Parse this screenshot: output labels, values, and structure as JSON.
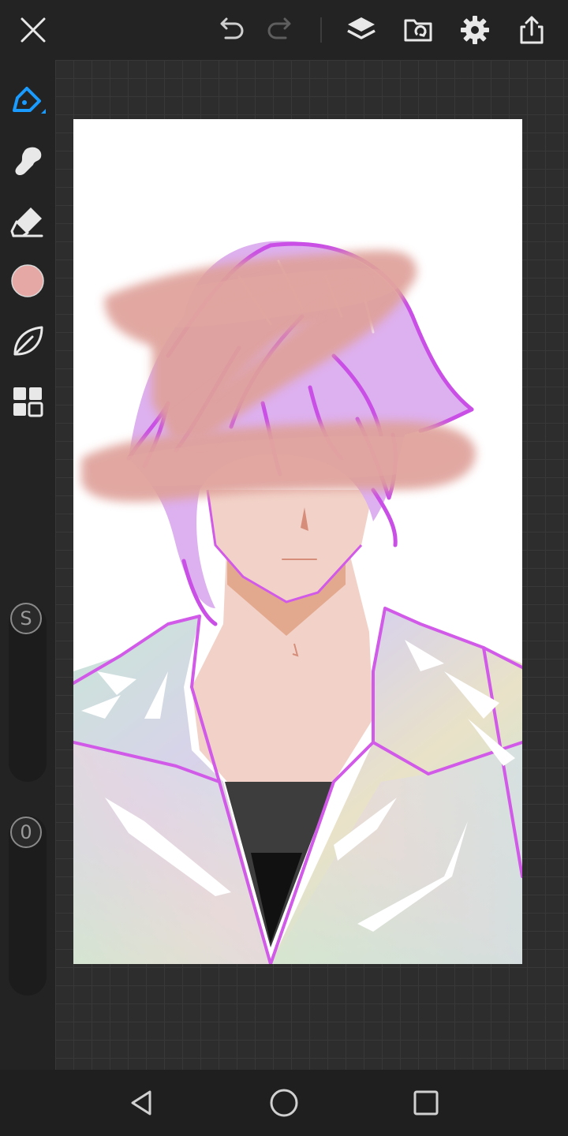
{
  "app": {
    "accent_color": "#1a9bff",
    "current_brush_color": "#e6a8a4"
  },
  "toolbar": {
    "close_icon": "close-icon",
    "undo_icon": "undo-icon",
    "redo_icon": "redo-icon",
    "layers_icon": "layers-icon",
    "gallery_icon": "gallery-icon",
    "settings_icon": "gear-icon",
    "share_icon": "share-icon"
  },
  "tools": [
    {
      "name": "pen",
      "icon": "pen-icon",
      "active": true
    },
    {
      "name": "smudge",
      "icon": "smudge-icon",
      "active": false
    },
    {
      "name": "eraser",
      "icon": "eraser-icon",
      "active": false
    },
    {
      "name": "color",
      "icon": "color-swatch",
      "active": false
    },
    {
      "name": "brush-library",
      "icon": "leaf-icon",
      "active": false
    },
    {
      "name": "widgets",
      "icon": "grid-icon",
      "active": false
    }
  ],
  "sliders": {
    "size_label": "S",
    "opacity_label": "0"
  },
  "nav": {
    "back_icon": "back-icon",
    "home_icon": "home-icon",
    "recents_icon": "recents-icon"
  }
}
